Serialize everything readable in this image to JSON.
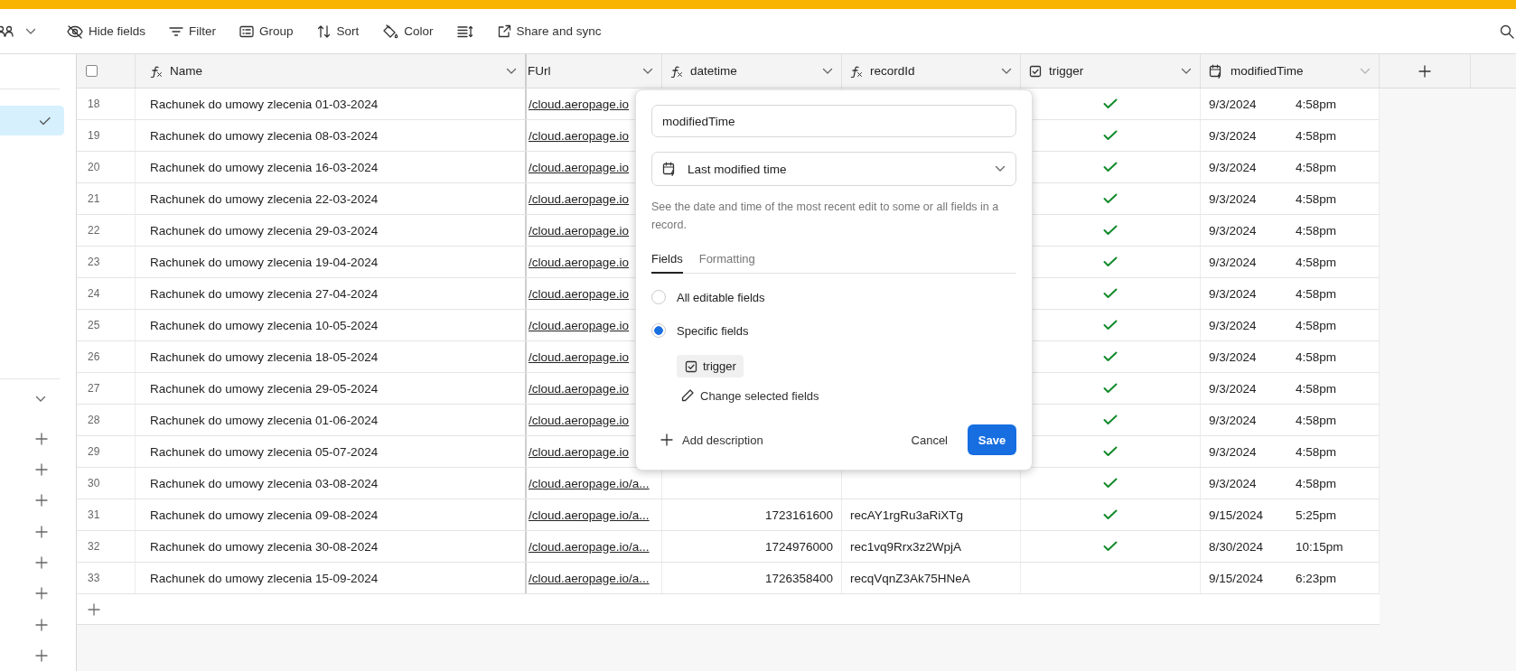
{
  "toolbar": {
    "items": [
      {
        "kind": "labeled",
        "label": "Hide fields"
      },
      {
        "kind": "labeled",
        "label": "Filter"
      },
      {
        "kind": "labeled",
        "label": "Group"
      },
      {
        "kind": "labeled",
        "label": "Sort"
      },
      {
        "kind": "labeled",
        "label": "Color"
      },
      {
        "kind": "icon_only"
      },
      {
        "kind": "labeled",
        "label": "Share and sync"
      }
    ]
  },
  "sidebar": {
    "items": [
      {
        "selected": true
      }
    ]
  },
  "table": {
    "select_all": {
      "checked": false
    },
    "columns": [
      {
        "label": "Name",
        "kind": "formula"
      },
      {
        "label": "FUrl",
        "kind": "plain"
      },
      {
        "label": "datetime",
        "kind": "formula"
      },
      {
        "label": "recordId",
        "kind": "formula"
      },
      {
        "label": "trigger",
        "kind": "checkbox"
      },
      {
        "label": "modifiedTime",
        "kind": "modified"
      }
    ],
    "rows": [
      {
        "number": "18",
        "name": "Rachunek do umowy zlecenia 01-03-2024",
        "url": "/cloud.aeropage.io",
        "trigger": true,
        "modified_date": "9/3/2024",
        "modified_time": "4:58pm"
      },
      {
        "number": "19",
        "name": "Rachunek do umowy zlecenia 08-03-2024",
        "url": "/cloud.aeropage.io",
        "trigger": true,
        "modified_date": "9/3/2024",
        "modified_time": "4:58pm"
      },
      {
        "number": "20",
        "name": "Rachunek do umowy zlecenia 16-03-2024",
        "url": "/cloud.aeropage.io",
        "trigger": true,
        "modified_date": "9/3/2024",
        "modified_time": "4:58pm"
      },
      {
        "number": "21",
        "name": "Rachunek do umowy zlecenia 22-03-2024",
        "url": "/cloud.aeropage.io",
        "trigger": true,
        "modified_date": "9/3/2024",
        "modified_time": "4:58pm"
      },
      {
        "number": "22",
        "name": "Rachunek do umowy zlecenia 29-03-2024",
        "url": "/cloud.aeropage.io",
        "trigger": true,
        "modified_date": "9/3/2024",
        "modified_time": "4:58pm"
      },
      {
        "number": "23",
        "name": "Rachunek do umowy zlecenia 19-04-2024",
        "url": "/cloud.aeropage.io",
        "trigger": true,
        "modified_date": "9/3/2024",
        "modified_time": "4:58pm"
      },
      {
        "number": "24",
        "name": "Rachunek do umowy zlecenia 27-04-2024",
        "url": "/cloud.aeropage.io",
        "trigger": true,
        "modified_date": "9/3/2024",
        "modified_time": "4:58pm"
      },
      {
        "number": "25",
        "name": "Rachunek do umowy zlecenia 10-05-2024",
        "url": "/cloud.aeropage.io",
        "trigger": true,
        "modified_date": "9/3/2024",
        "modified_time": "4:58pm"
      },
      {
        "number": "26",
        "name": "Rachunek do umowy zlecenia 18-05-2024",
        "url": "/cloud.aeropage.io",
        "trigger": true,
        "modified_date": "9/3/2024",
        "modified_time": "4:58pm"
      },
      {
        "number": "27",
        "name": "Rachunek do umowy zlecenia 29-05-2024",
        "url": "/cloud.aeropage.io",
        "trigger": true,
        "modified_date": "9/3/2024",
        "modified_time": "4:58pm"
      },
      {
        "number": "28",
        "name": "Rachunek do umowy zlecenia 01-06-2024",
        "url": "/cloud.aeropage.io",
        "trigger": true,
        "modified_date": "9/3/2024",
        "modified_time": "4:58pm"
      },
      {
        "number": "29",
        "name": "Rachunek do umowy zlecenia 05-07-2024",
        "url": "/cloud.aeropage.io",
        "trigger": true,
        "modified_date": "9/3/2024",
        "modified_time": "4:58pm"
      },
      {
        "number": "30",
        "name": "Rachunek do umowy zlecenia 03-08-2024",
        "url": "/cloud.aeropage.io/a...",
        "trigger": true,
        "modified_date": "9/3/2024",
        "modified_time": "4:58pm"
      },
      {
        "number": "31",
        "name": "Rachunek do umowy zlecenia 09-08-2024",
        "url": "/cloud.aeropage.io/a...",
        "datetime": "1723161600",
        "record_id": "recAY1rgRu3aRiXTg",
        "trigger": true,
        "modified_date": "9/15/2024",
        "modified_time": "5:25pm"
      },
      {
        "number": "32",
        "name": "Rachunek do umowy zlecenia 30-08-2024",
        "url": "/cloud.aeropage.io/a...",
        "datetime": "1724976000",
        "record_id": "rec1vq9Rrx3z2WpjA",
        "trigger": true,
        "modified_date": "8/30/2024",
        "modified_time": "10:15pm"
      },
      {
        "number": "33",
        "name": "Rachunek do umowy zlecenia 15-09-2024",
        "url": "/cloud.aeropage.io/a...",
        "datetime": "1726358400",
        "record_id": "recqVqnZ3Ak75HNeA",
        "trigger": false,
        "modified_date": "9/15/2024",
        "modified_time": "6:23pm"
      }
    ]
  },
  "field_editor": {
    "name_value": "modifiedTime",
    "type_label": "Last modified time",
    "description": "See the date and time of the most recent edit to some or all fields in a record.",
    "tabs": [
      {
        "label": "Fields",
        "selected": true
      },
      {
        "label": "Formatting",
        "selected": false
      }
    ],
    "options": [
      {
        "label": "All editable fields",
        "selected": false
      },
      {
        "label": "Specific fields",
        "selected": true
      }
    ],
    "selected_fields": [
      "trigger"
    ],
    "change_link": "Change selected fields",
    "add_description": "Add description",
    "cancel": "Cancel",
    "save": "Save"
  }
}
